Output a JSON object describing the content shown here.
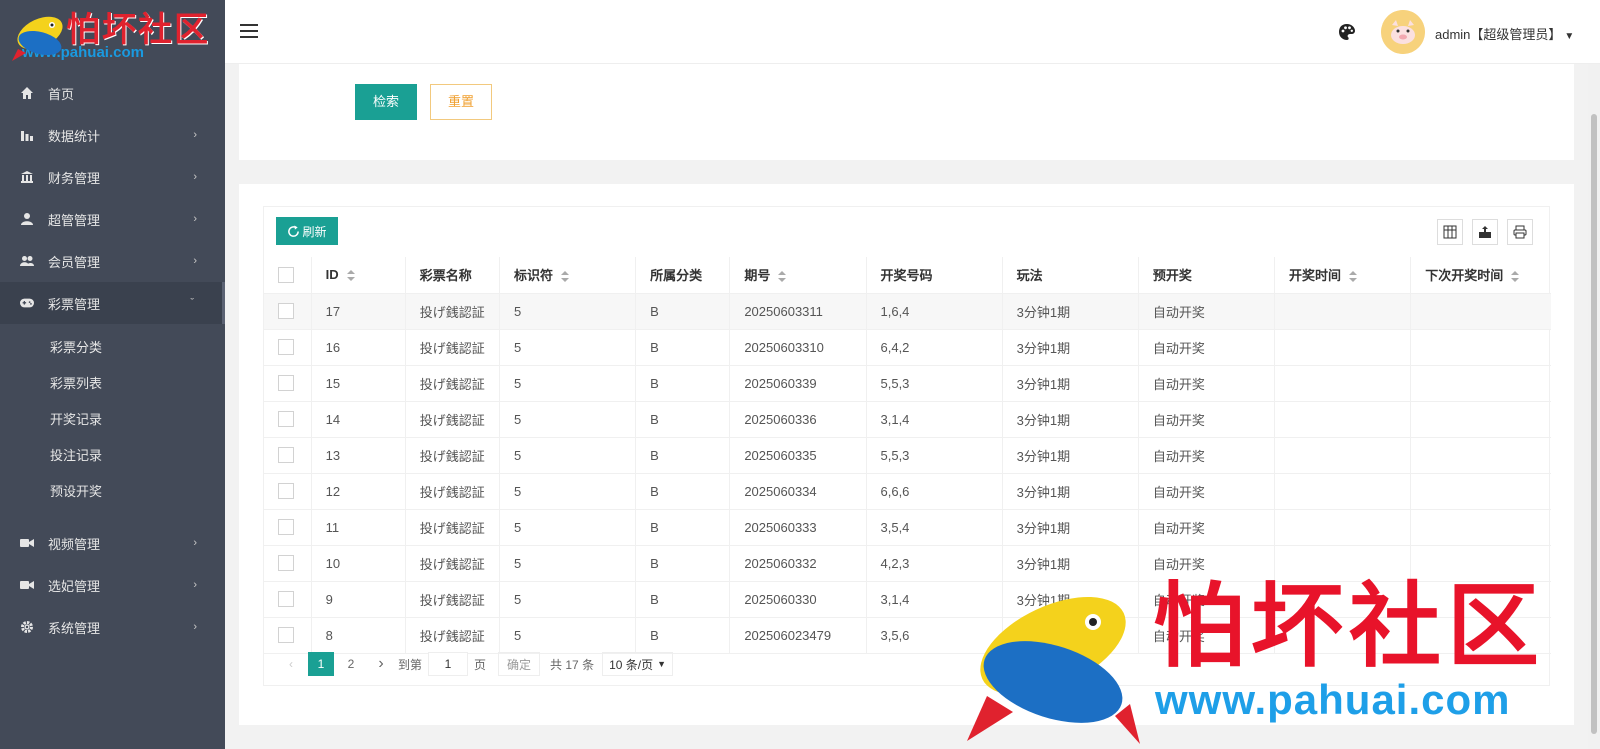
{
  "logo": {
    "title": "怕坏社区",
    "url": "www.pahuai.com"
  },
  "sidebar": {
    "items": [
      {
        "label": "首页",
        "icon": "home-icon"
      },
      {
        "label": "数据统计",
        "icon": "bar-chart-icon"
      },
      {
        "label": "财务管理",
        "icon": "bank-icon"
      },
      {
        "label": "超管管理",
        "icon": "user-icon"
      },
      {
        "label": "会员管理",
        "icon": "users-icon"
      },
      {
        "label": "彩票管理",
        "icon": "gamepad-icon"
      }
    ],
    "sub_items": [
      "彩票分类",
      "彩票列表",
      "开奖记录",
      "投注记录",
      "预设开奖"
    ],
    "items_after": [
      {
        "label": "视频管理",
        "icon": "video-icon"
      },
      {
        "label": "选妃管理",
        "icon": "video-icon"
      },
      {
        "label": "系统管理",
        "icon": "gear-icon"
      }
    ]
  },
  "header": {
    "username": "admin【超级管理员】"
  },
  "search": {
    "search_label": "检索",
    "reset_label": "重置"
  },
  "toolbar": {
    "refresh_label": "刷新"
  },
  "table": {
    "columns": [
      "ID",
      "彩票名称",
      "标识符",
      "所属分类",
      "期号",
      "开奖号码",
      "玩法",
      "预开奖",
      "开奖时间",
      "下次开奖时间"
    ],
    "rows": [
      [
        "17",
        "投げ銭認証",
        "5",
        "B",
        "20250603311",
        "1,6,4",
        "3分钟1期",
        "自动开奖",
        "",
        ""
      ],
      [
        "16",
        "投げ銭認証",
        "5",
        "B",
        "20250603310",
        "6,4,2",
        "3分钟1期",
        "自动开奖",
        "",
        ""
      ],
      [
        "15",
        "投げ銭認証",
        "5",
        "B",
        "2025060339",
        "5,5,3",
        "3分钟1期",
        "自动开奖",
        "",
        ""
      ],
      [
        "14",
        "投げ銭認証",
        "5",
        "B",
        "2025060336",
        "3,1,4",
        "3分钟1期",
        "自动开奖",
        "",
        ""
      ],
      [
        "13",
        "投げ銭認証",
        "5",
        "B",
        "2025060335",
        "5,5,3",
        "3分钟1期",
        "自动开奖",
        "",
        ""
      ],
      [
        "12",
        "投げ銭認証",
        "5",
        "B",
        "2025060334",
        "6,6,6",
        "3分钟1期",
        "自动开奖",
        "",
        ""
      ],
      [
        "11",
        "投げ銭認証",
        "5",
        "B",
        "2025060333",
        "3,5,4",
        "3分钟1期",
        "自动开奖",
        "",
        ""
      ],
      [
        "10",
        "投げ銭認証",
        "5",
        "B",
        "2025060332",
        "4,2,3",
        "3分钟1期",
        "自动开奖",
        "",
        ""
      ],
      [
        "9",
        "投げ銭認証",
        "5",
        "B",
        "2025060330",
        "3,1,4",
        "3分钟1期",
        "自动开奖",
        "",
        ""
      ],
      [
        "8",
        "投げ銭認証",
        "5",
        "B",
        "202506023479",
        "3,5,6",
        "3分钟1期",
        "自动开奖",
        "",
        ""
      ]
    ]
  },
  "pager": {
    "pages": [
      "1",
      "2"
    ],
    "goto_label": "到第",
    "goto_value": "1",
    "page_unit": "页",
    "confirm_label": "确定",
    "total": "共 17 条",
    "page_size": "10 条/页"
  },
  "watermark": {
    "title": "怕坏社区",
    "url": "www.pahuai.com"
  },
  "colors": {
    "accent": "#1aa094",
    "sidebar_bg": "#434a58",
    "reset": "#f0a030"
  }
}
